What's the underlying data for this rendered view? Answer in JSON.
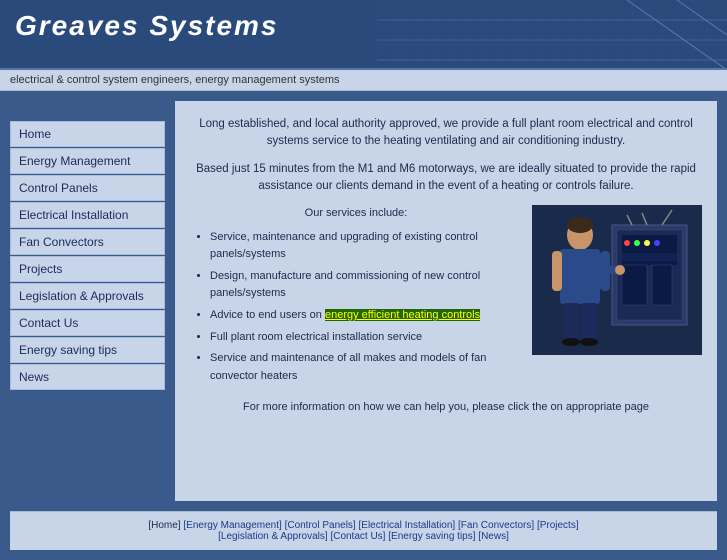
{
  "header": {
    "title": "Greaves  Systems",
    "tagline": "electrical & control system engineers, energy management systems"
  },
  "sidebar": {
    "items": [
      {
        "label": "Home",
        "id": "home"
      },
      {
        "label": "Energy Management",
        "id": "energy-management"
      },
      {
        "label": "Control Panels",
        "id": "control-panels"
      },
      {
        "label": "Electrical Installation",
        "id": "electrical-installation"
      },
      {
        "label": "Fan Convectors",
        "id": "fan-convectors"
      },
      {
        "label": "Projects",
        "id": "projects"
      },
      {
        "label": "Legislation & Approvals",
        "id": "legislation"
      },
      {
        "label": "Contact Us",
        "id": "contact-us"
      },
      {
        "label": "Energy saving tips",
        "id": "energy-saving-tips"
      },
      {
        "label": "News",
        "id": "news"
      }
    ]
  },
  "content": {
    "intro1": "Long established, and local authority approved, we provide a full plant room electrical and control systems service to the heating ventilating and air conditioning industry.",
    "intro2": "Based just 15 minutes from the M1 and M6 motorways, we are ideally situated to provide the rapid assistance our clients demand in the event of a heating or controls failure.",
    "services_header": "Our services include:",
    "services": [
      "Service, maintenance and upgrading of existing control panels/systems",
      "Design, manufacture and commissioning of new control panels/systems",
      "Advice to end users on energy efficient heating controls",
      "Full plant room electrical installation service",
      "Service and maintenance of all makes and models of fan convector heaters"
    ],
    "energy_link_text": "energy efficient heating controls",
    "more_info": "For more information on how we can help you, please click the on appropriate page"
  },
  "footer": {
    "links": [
      {
        "label": "Home",
        "id": "home"
      },
      {
        "label": "Energy Management",
        "id": "energy-management"
      },
      {
        "label": "Control Panels",
        "id": "control-panels"
      },
      {
        "label": "Electrical Installation",
        "id": "electrical-installation"
      },
      {
        "label": "Fan Convectors",
        "id": "fan-convectors"
      },
      {
        "label": "Projects",
        "id": "projects"
      },
      {
        "label": "Legislation & Approvals",
        "id": "legislation"
      },
      {
        "label": "Contact Us",
        "id": "contact-us"
      },
      {
        "label": "Energy saving tips",
        "id": "energy-saving-tips"
      },
      {
        "label": "News",
        "id": "news"
      }
    ]
  }
}
